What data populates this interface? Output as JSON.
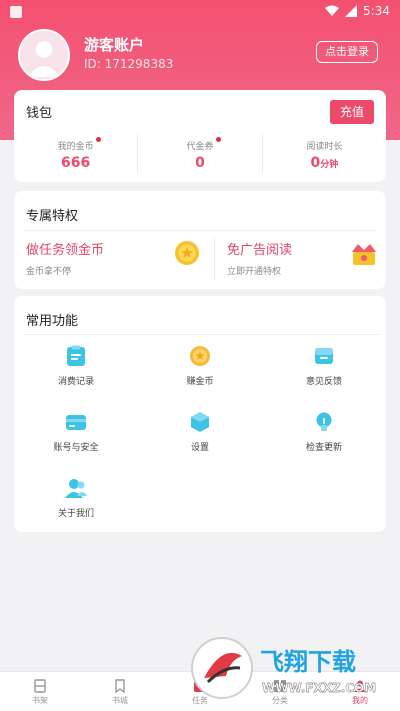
{
  "status_bar": {
    "time": "5:34"
  },
  "profile": {
    "name": "游客账户",
    "id_text": "ID: 171298383",
    "login_label": "点击登录"
  },
  "wallet": {
    "title": "钱包",
    "recharge_label": "充值",
    "stats": [
      {
        "label": "我的金币",
        "value": "666",
        "unit": "",
        "dot": true
      },
      {
        "label": "代金券",
        "value": "0",
        "unit": "",
        "dot": true
      },
      {
        "label": "阅读时长",
        "value": "0",
        "unit": "分钟",
        "dot": false
      }
    ]
  },
  "privileges": {
    "title": "专属特权",
    "items": [
      {
        "title": "做任务领金币",
        "subtitle": "金币拿不停",
        "icon": "gold-coin-icon"
      },
      {
        "title": "免广告阅读",
        "subtitle": "立即开通特权",
        "icon": "crown-icon"
      }
    ]
  },
  "functions": {
    "title": "常用功能",
    "items": [
      {
        "label": "消费记录",
        "icon": "receipt-icon",
        "color": "#3cc3e6"
      },
      {
        "label": "赚金币",
        "icon": "coin-icon",
        "color": "#f5b93a"
      },
      {
        "label": "意见反馈",
        "icon": "feedback-icon",
        "color": "#3cc3e6"
      },
      {
        "label": "账号与安全",
        "icon": "card-icon",
        "color": "#3cc3e6"
      },
      {
        "label": "设置",
        "icon": "cube-icon",
        "color": "#3cc3e6"
      },
      {
        "label": "检查更新",
        "icon": "lightbulb-icon",
        "color": "#3cc3e6"
      },
      {
        "label": "关于我们",
        "icon": "users-icon",
        "color": "#3cc3e6"
      }
    ]
  },
  "tabbar": {
    "items": [
      {
        "label": "书架",
        "icon": "bookshelf-icon",
        "active": false
      },
      {
        "label": "书城",
        "icon": "bookmark-icon",
        "active": false
      },
      {
        "label": "任务",
        "icon": "task-icon",
        "active": false
      },
      {
        "label": "分类",
        "icon": "category-icon",
        "active": false
      },
      {
        "label": "我的",
        "icon": "profile-icon",
        "active": true
      }
    ]
  },
  "watermark": {
    "brand": "飞翔下载",
    "url": "WWW.FXXZ.COM"
  },
  "colors": {
    "accent": "#ec4a6c",
    "icon_blue": "#3cc3e6"
  }
}
